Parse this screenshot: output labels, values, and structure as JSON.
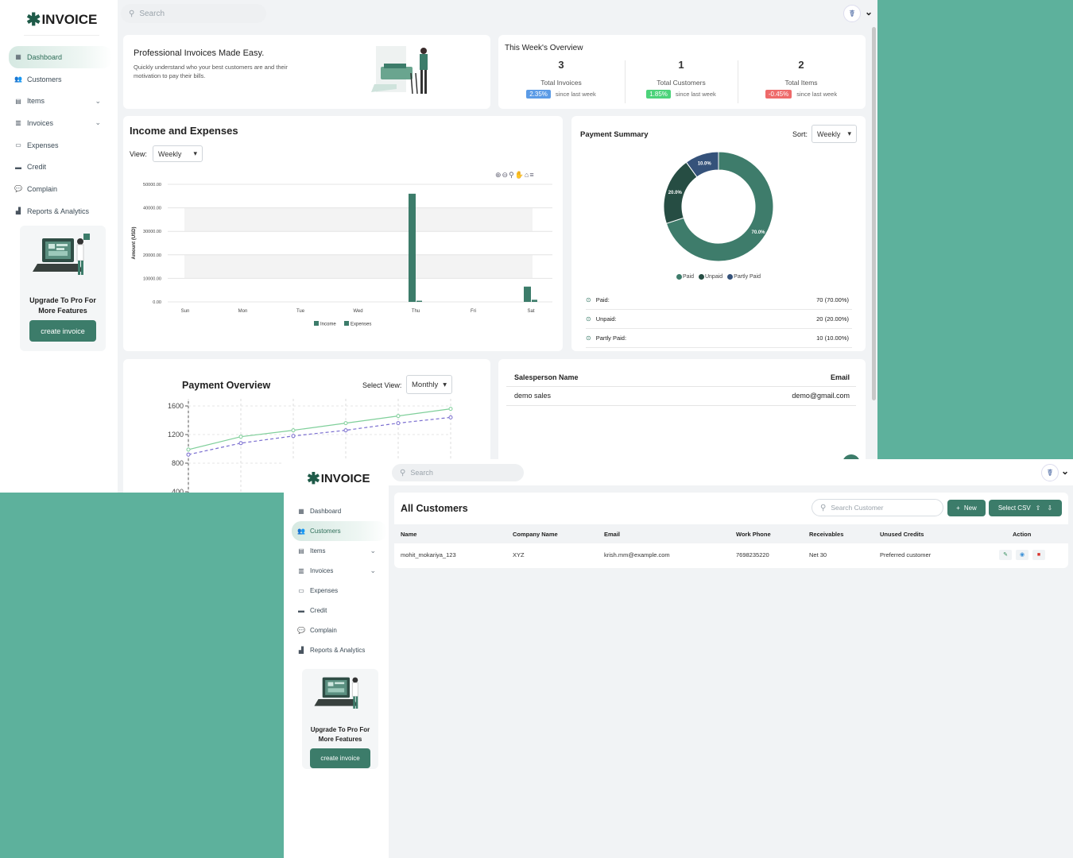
{
  "brand": {
    "logo_text": "INVOICE",
    "search_placeholder": "Search"
  },
  "nav": [
    {
      "label": "Dashboard",
      "icon": "grid-icon",
      "chevron": false
    },
    {
      "label": "Customers",
      "icon": "users-icon",
      "chevron": false
    },
    {
      "label": "Items",
      "icon": "box-icon",
      "chevron": true
    },
    {
      "label": "Invoices",
      "icon": "file-icon",
      "chevron": true
    },
    {
      "label": "Expenses",
      "icon": "money-icon",
      "chevron": false
    },
    {
      "label": "Credit",
      "icon": "card-icon",
      "chevron": false
    },
    {
      "label": "Complain",
      "icon": "chat-icon",
      "chevron": false
    },
    {
      "label": "Reports & Analytics",
      "icon": "chart-icon",
      "chevron": false
    }
  ],
  "promo": {
    "line1": "Upgrade To Pro For",
    "line2": "More Features",
    "button": "create invoice"
  },
  "hero": {
    "title": "Professional Invoices Made Easy.",
    "text_line1": "Quickly understand who your best customers are and their",
    "text_line2": "motivation to pay their bills."
  },
  "overview": {
    "title": "This Week's Overview",
    "cols": [
      {
        "num": "3",
        "label": "Total Invoices",
        "badge": "2.35%",
        "badge_color": "#5b9be6",
        "since": "since last week"
      },
      {
        "num": "1",
        "label": "Total Customers",
        "badge": "1.85%",
        "badge_color": "#4cd37a",
        "since": "since last week"
      },
      {
        "num": "2",
        "label": "Total Items",
        "badge": "-0.45%",
        "badge_color": "#ee6a6a",
        "since": "since last week"
      }
    ]
  },
  "income": {
    "title": "Income and Expenses",
    "view_label": "View:",
    "view_value": "Weekly",
    "toolbar_icons": [
      "zoom-in-icon",
      "zoom-out-icon",
      "magnify-icon",
      "pan-icon",
      "home-icon",
      "menu-icon"
    ]
  },
  "chart_data": [
    {
      "type": "bar",
      "title": "Income and Expenses",
      "ylabel": "Amount (USD)",
      "categories": [
        "Sun",
        "Mon",
        "Tue",
        "Wed",
        "Thu",
        "Fri",
        "Sat"
      ],
      "yticks": [
        "0.00",
        "10000.00",
        "20000.00",
        "30000.00",
        "40000.00",
        "50000.00"
      ],
      "ylim": [
        0,
        50000
      ],
      "series": [
        {
          "name": "Income",
          "color": "#3c7c6a",
          "values": [
            0,
            0,
            0,
            0,
            46000,
            0,
            6500
          ]
        },
        {
          "name": "Expenses",
          "color": "#3c7c6a",
          "values": [
            0,
            0,
            0,
            0,
            500,
            0,
            900
          ]
        }
      ]
    },
    {
      "type": "pie",
      "title": "Payment Summary",
      "labels": [
        "Paid",
        "Unpaid",
        "Partly Paid"
      ],
      "values": [
        70,
        20,
        10
      ],
      "colors": [
        "#3e7c6b",
        "#264d43",
        "#35527a"
      ],
      "slice_labels": [
        "70.0%",
        "20.0%",
        "10.0%"
      ]
    },
    {
      "type": "line",
      "title": "Payment Overview",
      "yticks": [
        "1600",
        "1200",
        "800",
        "400"
      ],
      "ylim": [
        200,
        1700
      ],
      "series": [
        {
          "name": "",
          "color": "#7fcf9a",
          "values": [
            990,
            1170,
            1260,
            1360,
            1460,
            1560
          ]
        },
        {
          "name": "",
          "color": "#7b6fd0",
          "values": [
            920,
            1080,
            1180,
            1260,
            1360,
            1440
          ]
        }
      ]
    }
  ],
  "payment_summary": {
    "title": "Payment Summary",
    "sort_label": "Sort:",
    "sort_value": "Weekly",
    "rows": [
      {
        "label": "Paid:",
        "value": "70 (70.00%)"
      },
      {
        "label": "Unpaid:",
        "value": "20 (20.00%)"
      },
      {
        "label": "Partly Paid:",
        "value": "10 (10.00%)"
      }
    ]
  },
  "payment_overview": {
    "title": "Payment Overview",
    "select_label": "Select View:",
    "select_value": "Monthly"
  },
  "sales": {
    "col1": "Salesperson Name",
    "col2": "Email",
    "rows": [
      {
        "name": "demo sales",
        "email": "demo@gmail.com"
      }
    ]
  },
  "customers": {
    "title": "All Customers",
    "search_placeholder": "Search Customer",
    "new_button": "New",
    "csv_button": "Select CSV",
    "headers": [
      "Name",
      "Company Name",
      "Email",
      "Work Phone",
      "Receivables",
      "Unused Credits",
      "Action"
    ],
    "rows": [
      [
        "mohit_mokariya_123",
        "XYZ",
        "krish.mm@example.com",
        "7698235220",
        "Net 30",
        "Preferred customer"
      ]
    ]
  }
}
